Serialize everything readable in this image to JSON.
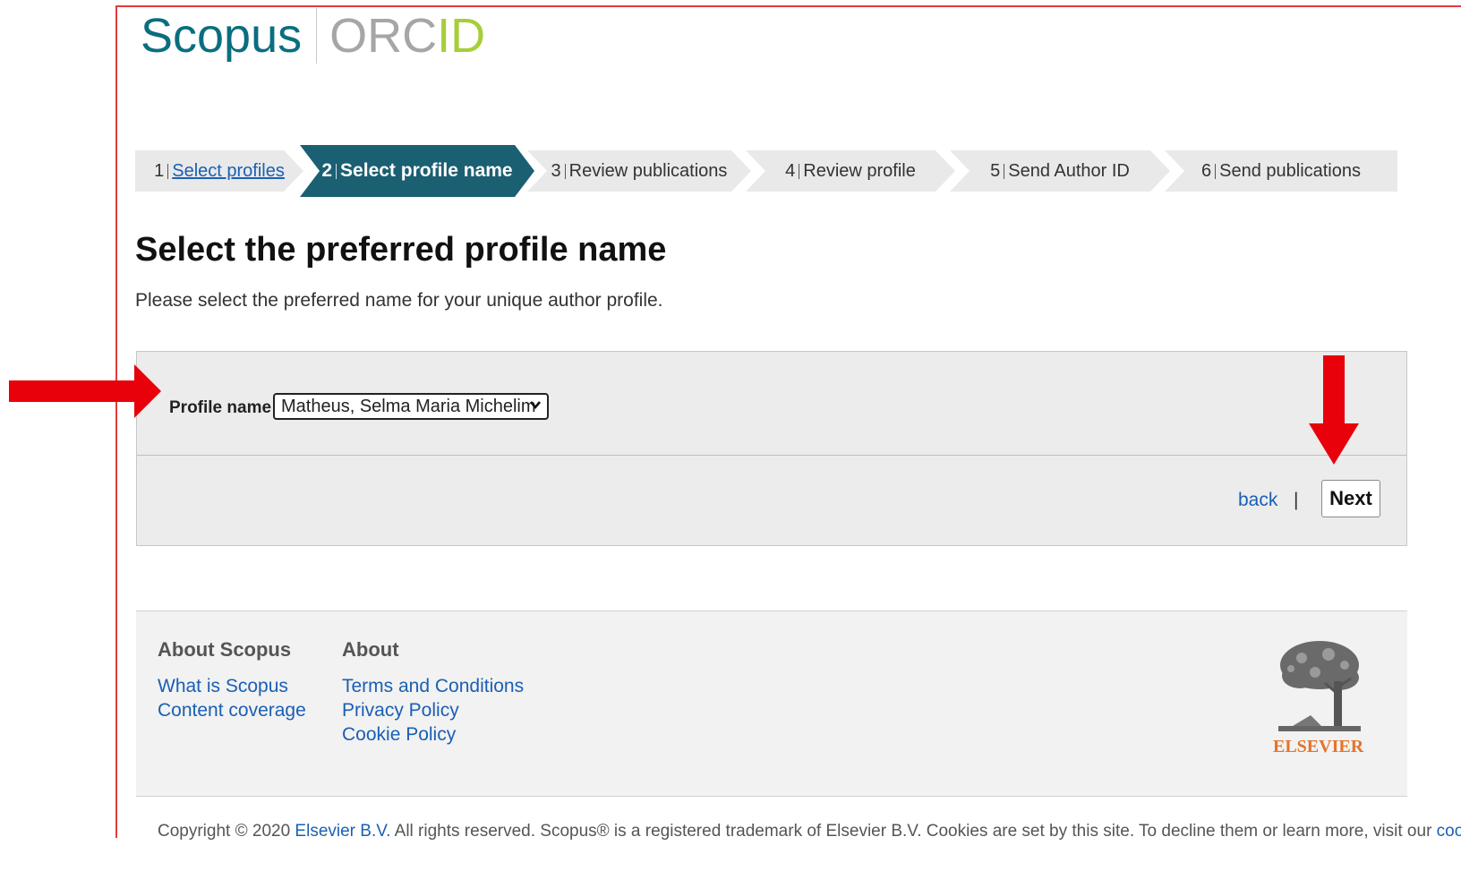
{
  "logo": {
    "scopus": "Scopus",
    "orc": "ORC",
    "id": "ID"
  },
  "stepper": [
    {
      "num": "1",
      "label": "Select profiles",
      "state": "done"
    },
    {
      "num": "2",
      "label": "Select profile name",
      "state": "active"
    },
    {
      "num": "3",
      "label": "Review publications",
      "state": "todo"
    },
    {
      "num": "4",
      "label": "Review profile",
      "state": "todo"
    },
    {
      "num": "5",
      "label": "Send Author ID",
      "state": "todo"
    },
    {
      "num": "6",
      "label": "Send publications",
      "state": "todo"
    }
  ],
  "page": {
    "title": "Select the preferred profile name",
    "description": "Please select the preferred name for your unique author profile."
  },
  "form": {
    "profile_label": "Profile name",
    "profile_selected": "Matheus, Selma Maria Michelim",
    "back_label": "back",
    "separator": "|",
    "next_label": "Next"
  },
  "footer": {
    "col1": {
      "heading": "About Scopus",
      "links": [
        "What is Scopus",
        "Content coverage"
      ]
    },
    "col2": {
      "heading": "About",
      "links": [
        "Terms and Conditions",
        "Privacy Policy",
        "Cookie Policy"
      ]
    },
    "publisher": "ELSEVIER"
  },
  "copyright": {
    "prefix": "Copyright © 2020 ",
    "link1": "Elsevier B.V.",
    "middle": " All rights reserved. Scopus® is a registered trademark of Elsevier B.V. Cookies are set by this site. To decline them or learn more, visit our ",
    "link2": "cookie"
  },
  "colors": {
    "accent": "#1b5f73",
    "annotation_arrow": "#e8000b",
    "link": "#1a5fb4"
  },
  "icons": [
    "chevron-down-icon",
    "elsevier-tree-logo",
    "annotation-arrow-right",
    "annotation-arrow-down"
  ]
}
